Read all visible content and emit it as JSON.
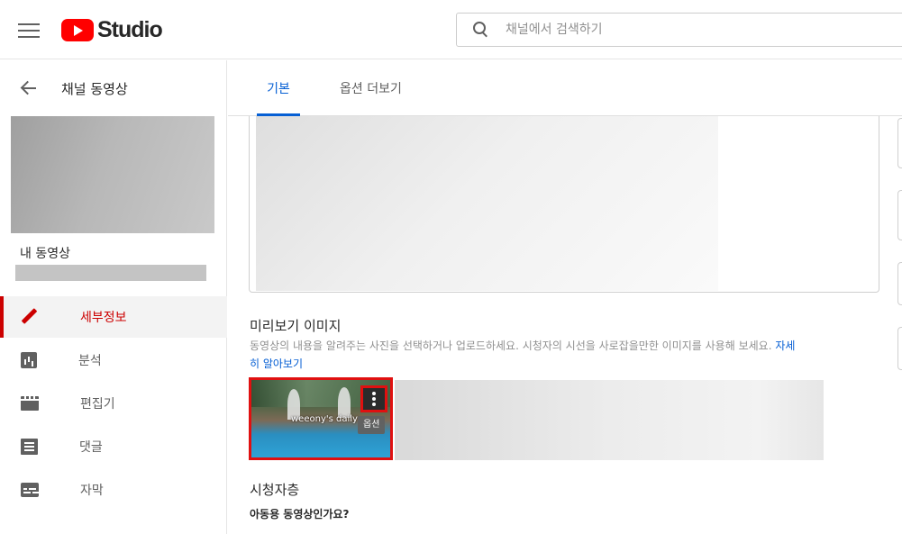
{
  "header": {
    "logo_text": "Studio",
    "search_placeholder": "채널에서 검색하기"
  },
  "sidebar": {
    "back_label": "채널 동영상",
    "my_video_label": "내 동영상",
    "nav": [
      {
        "label": "세부정보",
        "icon": "pencil-icon",
        "active": true
      },
      {
        "label": "분석",
        "icon": "analytics-icon"
      },
      {
        "label": "편집기",
        "icon": "editor-icon"
      },
      {
        "label": "댓글",
        "icon": "comments-icon"
      },
      {
        "label": "자막",
        "icon": "subtitles-icon"
      }
    ]
  },
  "tabs": [
    {
      "label": "기본",
      "active": true
    },
    {
      "label": "옵션 더보기"
    }
  ],
  "thumbnail_section": {
    "title": "미리보기 이미지",
    "description": "동영상의 내용을 알려주는 사진을 선택하거나 업로드하세요. 시청자의 시선을 사로잡을만한 이미지를 사용해 보세요.",
    "learn_more_part1": "자세",
    "learn_more_part2": "히 알아보기",
    "selected_thumb_text": "weeony's daily",
    "options_tooltip": "옵션"
  },
  "audience_section": {
    "title": "시청자층",
    "question": "아동용 동영상인가요?"
  },
  "colors": {
    "accent_red": "#cc0000",
    "link_blue": "#065fd4",
    "highlight_red": "#e01010"
  }
}
